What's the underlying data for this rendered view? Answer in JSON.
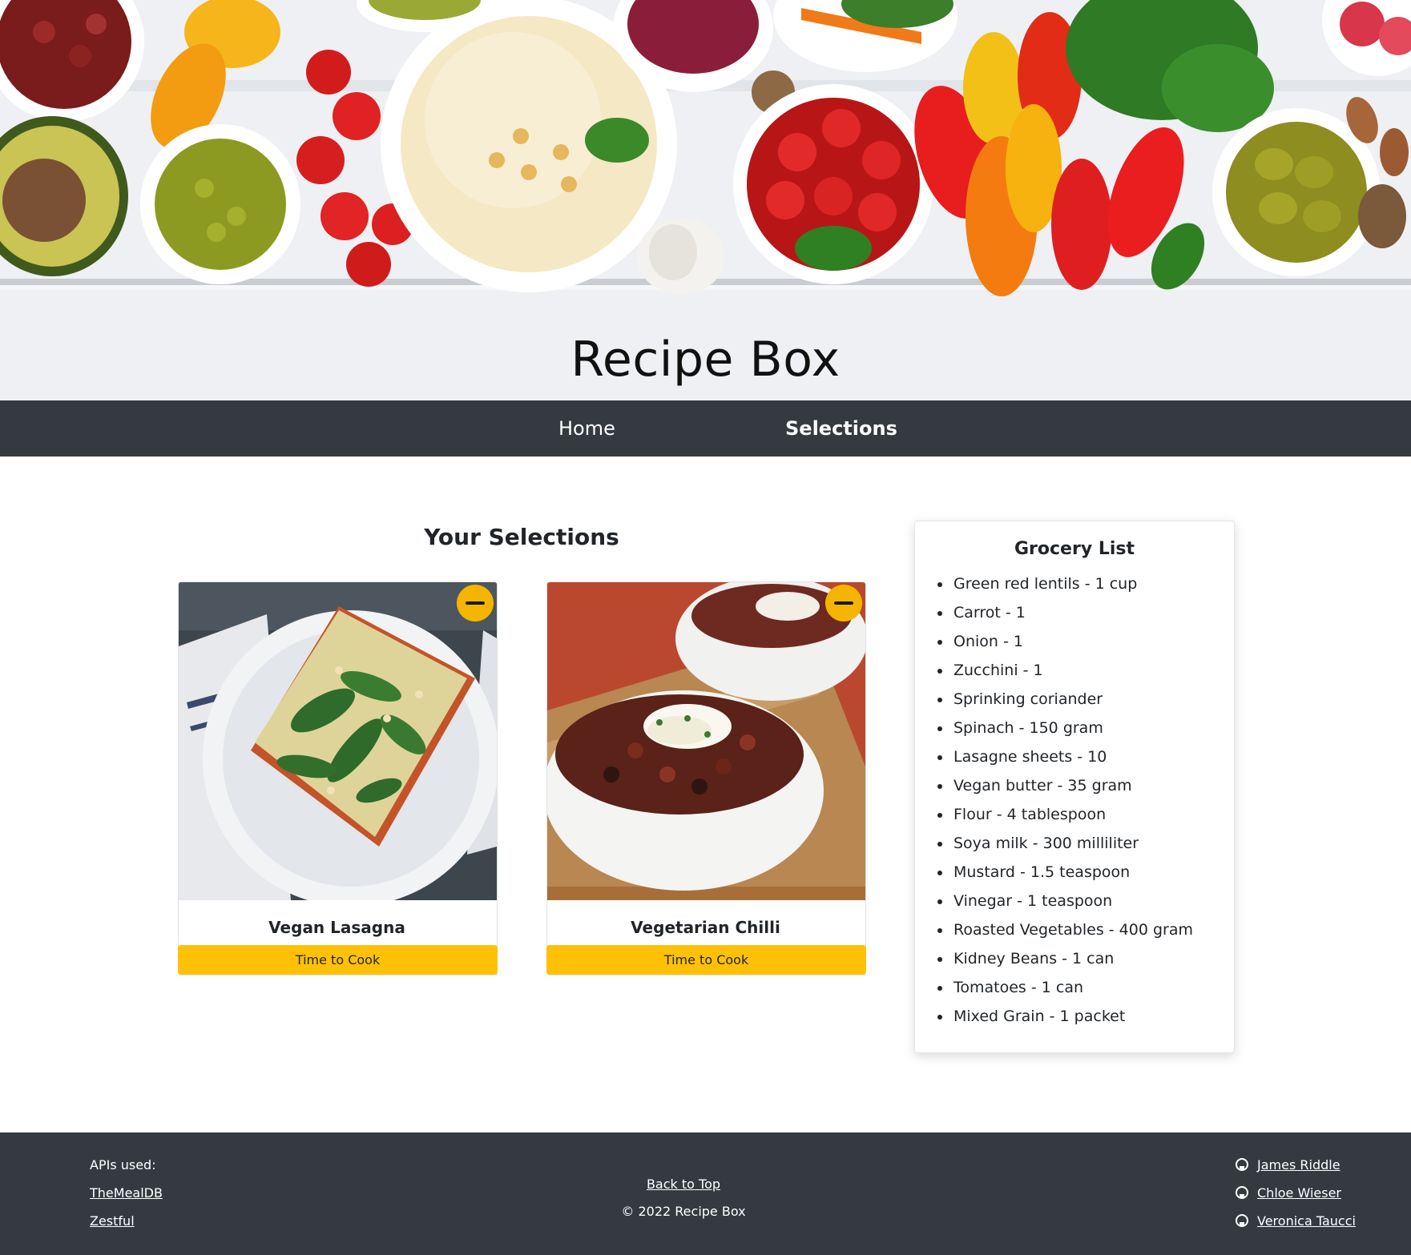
{
  "hero": {
    "title": "Recipe Box"
  },
  "nav": {
    "home": "Home",
    "selections": "Selections"
  },
  "selections": {
    "title": "Your Selections",
    "cards": [
      {
        "title": "Vegan Lasagna",
        "button": "Time to Cook",
        "image": "vegan-lasagna-photo"
      },
      {
        "title": "Vegetarian Chilli",
        "button": "Time to Cook",
        "image": "vegetarian-chilli-photo"
      }
    ]
  },
  "grocery": {
    "title": "Grocery List",
    "items": [
      "Green red lentils - 1 cup",
      "Carrot - 1",
      "Onion - 1",
      "Zucchini - 1",
      "Sprinking coriander",
      "Spinach - 150 gram",
      "Lasagne sheets - 10",
      "Vegan butter - 35 gram",
      "Flour - 4 tablespoon",
      "Soya milk - 300 milliliter",
      "Mustard - 1.5 teaspoon",
      "Vinegar - 1 teaspoon",
      "Roasted Vegetables - 400 gram",
      "Kidney Beans - 1 can",
      "Tomatoes - 1 can",
      "Mixed Grain - 1 packet"
    ]
  },
  "footer": {
    "apis_label": "APIs used:",
    "apis": [
      "TheMealDB",
      "Zestful"
    ],
    "back_to_top": "Back to Top",
    "copyright": "© 2022 Recipe Box",
    "authors": [
      "James Riddle",
      "Chloe Wieser",
      "Veronica Taucci"
    ]
  },
  "colors": {
    "nav_bg": "#343a40",
    "accent_yellow": "#ffc107",
    "remove_button": "#f4b400",
    "footer_bg": "#343a40"
  },
  "icons": {
    "remove": "minus-circle-icon",
    "author_link": "github-icon"
  }
}
